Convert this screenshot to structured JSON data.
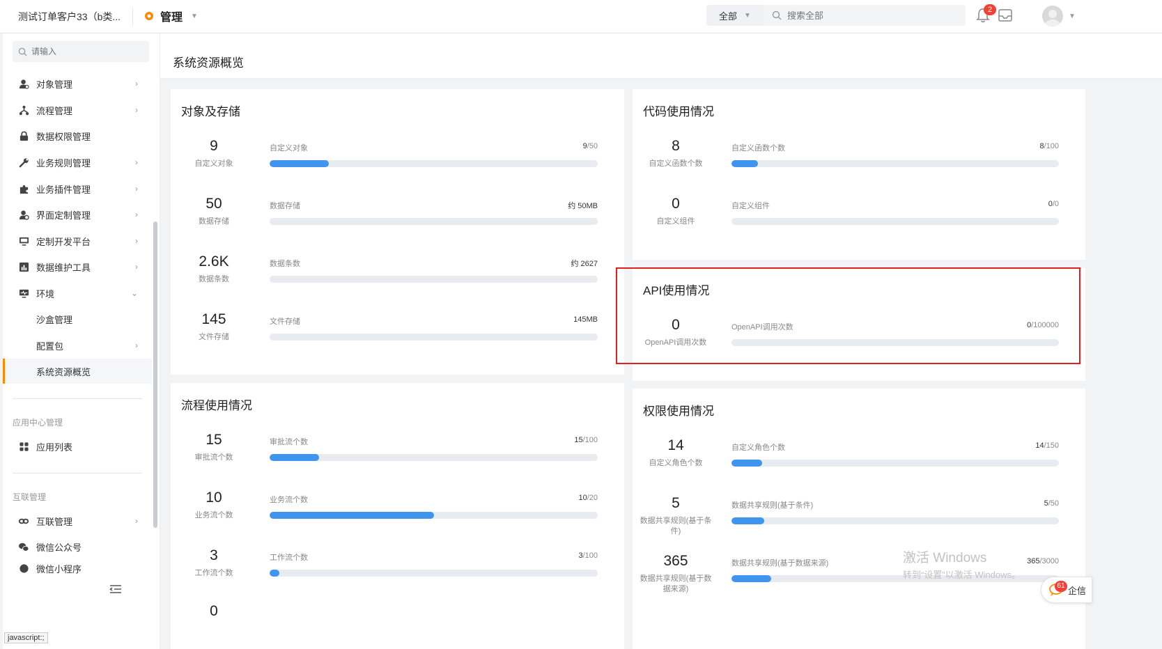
{
  "header": {
    "company": "测试订单客户33（b类...",
    "module": "管理",
    "scope": "全部",
    "search_placeholder": "搜索全部",
    "notification_count": "2"
  },
  "sidebar": {
    "search_placeholder": "请输入",
    "items": [
      {
        "label": "对象管理",
        "icon": "object-icon"
      },
      {
        "label": "流程管理",
        "icon": "flow-icon"
      },
      {
        "label": "数据权限管理",
        "icon": "lock-icon"
      },
      {
        "label": "业务规则管理",
        "icon": "wrench-icon"
      },
      {
        "label": "业务插件管理",
        "icon": "puzzle-icon"
      },
      {
        "label": "界面定制管理",
        "icon": "ui-custom-icon"
      },
      {
        "label": "定制开发平台",
        "icon": "monitor-icon"
      },
      {
        "label": "数据维护工具",
        "icon": "chart-icon"
      },
      {
        "label": "环境",
        "icon": "environment-icon"
      }
    ],
    "env_children": [
      "沙盒管理",
      "配置包",
      "系统资源概览"
    ],
    "group_app_center": "应用中心管理",
    "app_list": "应用列表",
    "group_interconnect": "互联管理",
    "interconnect": "互联管理",
    "wechat_official": "微信公众号",
    "wechat_mini": "微信小程序",
    "status_link": "javascript:;"
  },
  "page": {
    "title": "系统资源概览"
  },
  "cards": {
    "objects": {
      "title": "对象及存储",
      "metrics": [
        {
          "value": "9",
          "caption": "自定义对象",
          "label": "自定义对象",
          "used": "9",
          "total": "/50",
          "fraction": 0.18
        },
        {
          "value": "50",
          "caption": "数据存储",
          "label": "数据存储",
          "used": "约 50MB",
          "total": "",
          "fraction": 0
        },
        {
          "value": "2.6K",
          "caption": "数据条数",
          "label": "数据条数",
          "used": "约 2627",
          "total": "",
          "fraction": 0
        },
        {
          "value": "145",
          "caption": "文件存储",
          "label": "文件存储",
          "used": "145MB",
          "total": "",
          "fraction": 0
        }
      ]
    },
    "code": {
      "title": "代码使用情况",
      "metrics": [
        {
          "value": "8",
          "caption": "自定义函数个数",
          "label": "自定义函数个数",
          "used": "8",
          "total": "/100",
          "fraction": 0.08
        },
        {
          "value": "0",
          "caption": "自定义组件",
          "label": "自定义组件",
          "used": "0",
          "total": "/0",
          "fraction": 0
        }
      ]
    },
    "api": {
      "title": "API使用情况",
      "metrics": [
        {
          "value": "0",
          "caption": "OpenAPI调用次数",
          "label": "OpenAPI调用次数",
          "used": "0",
          "total": "/100000",
          "fraction": 0
        }
      ]
    },
    "flow": {
      "title": "流程使用情况",
      "metrics": [
        {
          "value": "15",
          "caption": "审批流个数",
          "label": "审批流个数",
          "used": "15",
          "total": "/100",
          "fraction": 0.15
        },
        {
          "value": "10",
          "caption": "业务流个数",
          "label": "业务流个数",
          "used": "10",
          "total": "/20",
          "fraction": 0.5
        },
        {
          "value": "3",
          "caption": "工作流个数",
          "label": "工作流个数",
          "used": "3",
          "total": "/100",
          "fraction": 0.03
        },
        {
          "value": "0",
          "caption": "",
          "label": "",
          "used": "",
          "total": "",
          "fraction": 0
        }
      ]
    },
    "permission": {
      "title": "权限使用情况",
      "metrics": [
        {
          "value": "14",
          "caption": "自定义角色个数",
          "label": "自定义角色个数",
          "used": "14",
          "total": "/150",
          "fraction": 0.093
        },
        {
          "value": "5",
          "caption": "数据共享规则(基于条件)",
          "label": "数据共享规则(基于条件)",
          "used": "5",
          "total": "/50",
          "fraction": 0.1
        },
        {
          "value": "365",
          "caption": "数据共享规则(基于数据来源)",
          "label": "数据共享规则(基于数据来源)",
          "used": "365",
          "total": "/3000",
          "fraction": 0.122
        }
      ]
    }
  },
  "watermark": {
    "line1": "激活 Windows",
    "line2": "转到“设置”以激活 Windows。"
  },
  "wecom": {
    "label": "企信",
    "count": "61"
  },
  "colors": {
    "accent": "#ff8a00",
    "bar_fill": "#3f95ee",
    "bar_track": "#e8ebf0",
    "highlight": "#e0201d"
  }
}
